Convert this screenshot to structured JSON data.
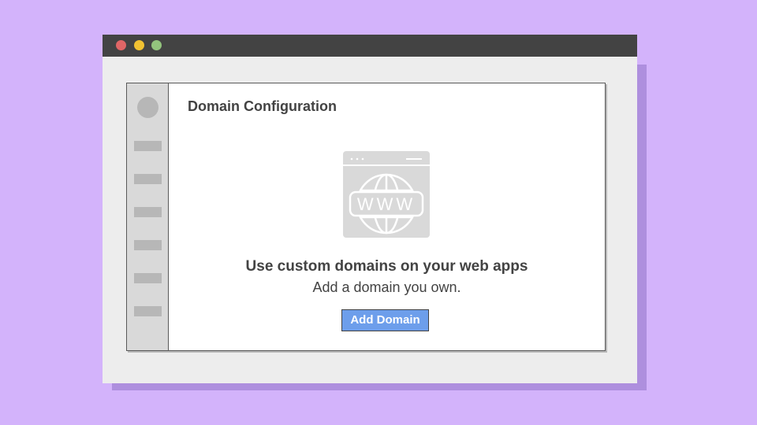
{
  "window": {
    "controls": [
      "close",
      "minimize",
      "maximize"
    ],
    "colors": {
      "close": "#e06666",
      "minimize": "#f1c232",
      "maximize": "#93c47d",
      "titlebar": "#434343"
    }
  },
  "sidebar": {
    "avatar_icon": "avatar-placeholder",
    "items": [
      "nav-placeholder",
      "nav-placeholder",
      "nav-placeholder",
      "nav-placeholder",
      "nav-placeholder",
      "nav-placeholder"
    ]
  },
  "main": {
    "title": "Domain Configuration",
    "illustration": {
      "icon": "www-globe-icon",
      "text": "WWW"
    },
    "empty_state": {
      "heading": "Use custom domains on your web apps",
      "subtext": "Add a domain you own."
    },
    "add_button_label": "Add Domain",
    "accent_color": "#6d9eeb"
  }
}
